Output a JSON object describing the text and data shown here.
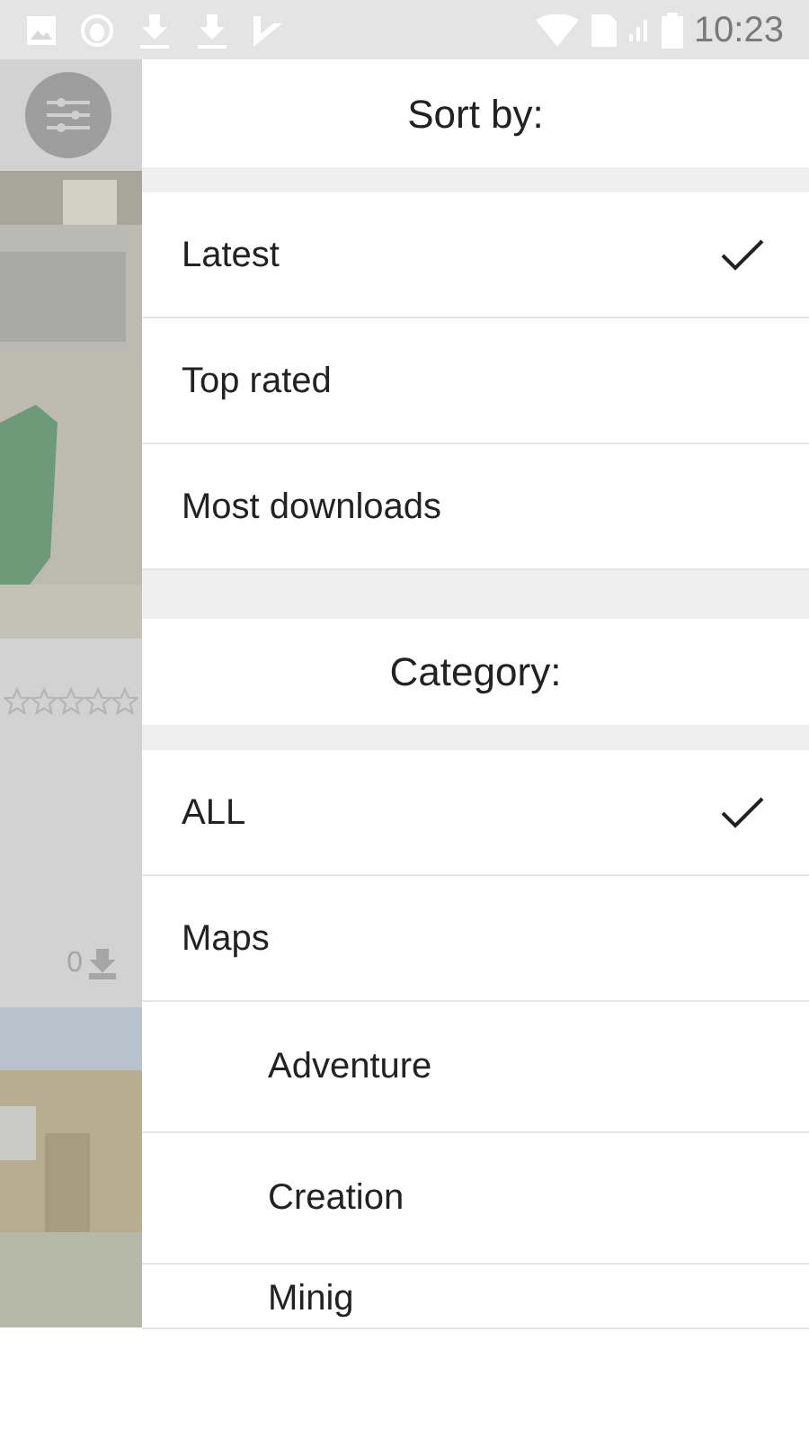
{
  "status_bar": {
    "time": "10:23"
  },
  "background_card": {
    "stars": 0,
    "downloads": "0"
  },
  "sort": {
    "title": "Sort by:",
    "options": [
      {
        "label": "Latest",
        "selected": true
      },
      {
        "label": "Top rated",
        "selected": false
      },
      {
        "label": "Most downloads",
        "selected": false
      }
    ]
  },
  "category": {
    "title": "Category:",
    "items": [
      {
        "label": "ALL",
        "selected": true
      },
      {
        "label": "Maps",
        "selected": false,
        "children": [
          {
            "label": "Adventure",
            "selected": false
          },
          {
            "label": "Creation",
            "selected": false
          },
          {
            "label": "Minig",
            "selected": false
          }
        ]
      }
    ]
  }
}
